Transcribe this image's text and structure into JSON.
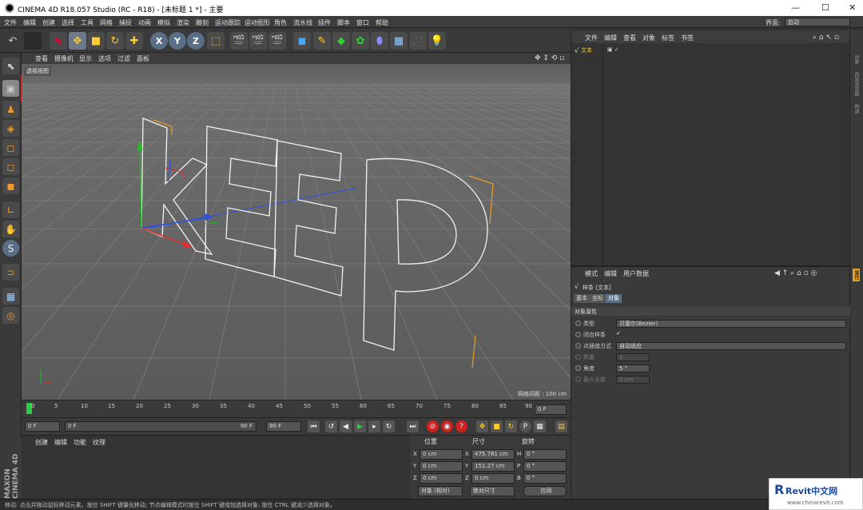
{
  "window": {
    "title": "CINEMA 4D R18.057 Studio (RC - R18) - [未标题 1 *] - 主要",
    "minimize": "—",
    "maximize": "☐",
    "close": "✕"
  },
  "menu": [
    "文件",
    "编辑",
    "创建",
    "选择",
    "工具",
    "网格",
    "捕捉",
    "动画",
    "模拟",
    "渲染",
    "雕刻",
    "运动跟踪",
    "运动图形",
    "角色",
    "流水线",
    "插件",
    "脚本",
    "窗口",
    "帮助"
  ],
  "layout": {
    "label": "界面:",
    "value": "启动"
  },
  "viewport": {
    "menu": [
      "查看",
      "摄像机",
      "显示",
      "选项",
      "过滤",
      "面板"
    ],
    "label": "透视视图",
    "grid_distance": "网格间距 : 100 cm",
    "text_object": "KEEP"
  },
  "timeline": {
    "ticks": [
      "0",
      "5",
      "10",
      "15",
      "20",
      "25",
      "30",
      "35",
      "40",
      "45",
      "50",
      "55",
      "60",
      "65",
      "70",
      "75",
      "80",
      "85",
      "90"
    ],
    "current": "0 F"
  },
  "transport": {
    "start": "0 F",
    "min": "0 F",
    "max": "90 F",
    "end": "90 F"
  },
  "material_manager": {
    "menu": [
      "创建",
      "编辑",
      "功能",
      "纹理"
    ]
  },
  "maxon": "MAXON CINEMA 4D",
  "coordinates": {
    "headers": [
      "位置",
      "尺寸",
      "旋转"
    ],
    "rows": [
      {
        "axis": "X",
        "pos": "0 cm",
        "size_axis": "X",
        "size": "475.781 cm",
        "rot_axis": "H",
        "rot": "0 °"
      },
      {
        "axis": "Y",
        "pos": "0 cm",
        "size_axis": "Y",
        "size": "151.27 cm",
        "rot_axis": "P",
        "rot": "0 °"
      },
      {
        "axis": "Z",
        "pos": "0 cm",
        "size_axis": "Z",
        "size": "0 cm",
        "rot_axis": "B",
        "rot": "0 °"
      }
    ],
    "mode": "对象 (相对)",
    "size_mode": "绝对尺寸",
    "apply": "应用"
  },
  "object_manager": {
    "menu": [
      "文件",
      "编辑",
      "查看",
      "对象",
      "标签",
      "书签"
    ],
    "objects": [
      {
        "name": "文本"
      }
    ]
  },
  "attributes": {
    "menu": [
      "模式",
      "编辑",
      "用户数据"
    ],
    "object_title": "样条 [文本]",
    "tabs": [
      "基本",
      "坐标",
      "对象"
    ],
    "section": "对象属性",
    "rows": [
      {
        "label": "类型",
        "value": "贝塞尔(Bezier)"
      },
      {
        "label": "闭合样条",
        "value": "✓"
      },
      {
        "label": "点插值方式",
        "value": "自动适应"
      },
      {
        "label": "数量",
        "value": "8"
      },
      {
        "label": "角度",
        "value": "5 °"
      },
      {
        "label": "最大长度",
        "value": "5 cm"
      }
    ]
  },
  "right_strip": [
    "对象",
    "内容浏览器",
    "构造",
    "属性"
  ],
  "status": "移动: 点击并拖动鼠标移动元素。按住 SHIFT 键量化移动; 节点编辑模式时按住 SHIFT 键增加选择对象; 按住 CTRL 键减少选择对象。",
  "watermark": {
    "brand": "Revit中文网",
    "url": "www.chinarevit.com"
  },
  "colors": {
    "accent_blue": "#5a6e85",
    "highlight_red": "#e02020",
    "axis_green": "#1fbf1f",
    "axis_red": "#e03030",
    "axis_blue": "#3050e0"
  }
}
